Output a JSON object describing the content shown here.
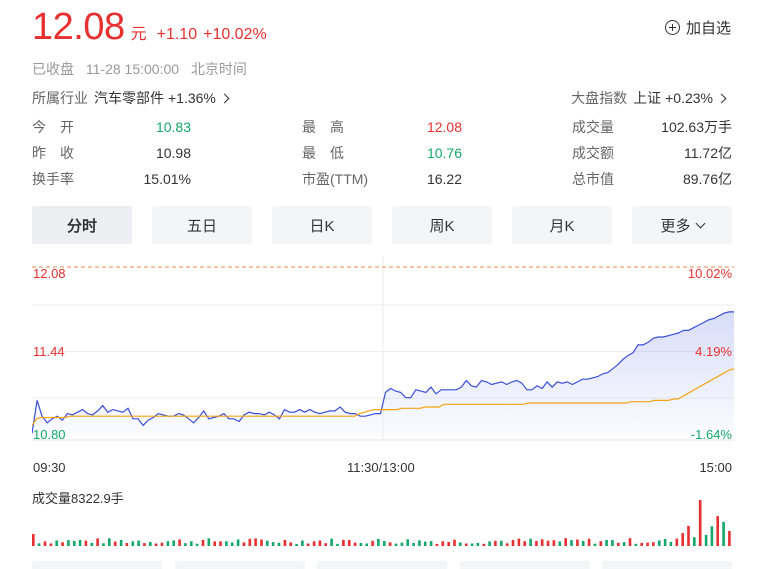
{
  "quote": {
    "price": "12.08",
    "unit": "元",
    "change": "+1.10",
    "change_pct": "+10.02%"
  },
  "watch_label": "加自选",
  "status": {
    "state": "已收盘",
    "datetime": "11-28 15:00:00",
    "timezone": "北京时间"
  },
  "industry": {
    "label": "所属行业",
    "name": "汽车零部件",
    "change": "+1.36%"
  },
  "market": {
    "label": "大盘指数",
    "name": "上证",
    "change": "+0.23%"
  },
  "stats": {
    "open_label": "今　开",
    "open": "10.83",
    "prev_close_label": "昨　收",
    "prev_close": "10.98",
    "turnover_rate_label": "换手率",
    "turnover_rate": "15.01%",
    "high_label": "最　高",
    "high": "12.08",
    "low_label": "最　低",
    "low": "10.76",
    "pe_label": "市盈(TTM)",
    "pe": "16.22",
    "volume_label": "成交量",
    "volume": "102.63万手",
    "amount_label": "成交额",
    "amount": "11.72亿",
    "market_cap_label": "总市值",
    "market_cap": "89.76亿"
  },
  "tabs": [
    "分时",
    "五日",
    "日K",
    "周K",
    "月K",
    "更多"
  ],
  "active_tab": "分时",
  "chart_data": {
    "type": "line",
    "y_left_labels": [
      "12.08",
      "11.44",
      "10.80"
    ],
    "y_right_labels": [
      "10.02%",
      "4.19%",
      "-1.64%"
    ],
    "x_labels": [
      "09:30",
      "11:30/13:00",
      "15:00"
    ],
    "ylim": [
      10.8,
      12.08
    ],
    "prev_close": 10.98,
    "limit_up": 12.08,
    "series": [
      {
        "color": "#3a4fd8",
        "values": [
          10.82,
          11.07,
          10.95,
          10.9,
          10.93,
          10.95,
          10.92,
          10.97,
          10.96,
          10.98,
          11.0,
          10.97,
          10.96,
          10.99,
          11.03,
          10.98,
          11.0,
          10.99,
          10.98,
          11.01,
          10.93,
          10.93,
          10.88,
          10.92,
          10.94,
          10.97,
          10.96,
          10.95,
          10.95,
          10.97,
          10.96,
          10.93,
          10.9,
          10.94,
          10.99,
          10.93,
          10.94,
          10.95,
          10.97,
          10.93,
          10.93,
          10.91,
          10.96,
          10.98,
          10.97,
          10.97,
          10.96,
          10.98,
          10.96,
          10.93,
          11.0,
          10.98,
          10.98,
          11.0,
          10.98,
          11.0,
          10.98,
          10.97,
          10.98,
          10.99,
          10.99,
          11.02,
          10.98,
          10.97,
          10.97,
          10.95,
          10.95,
          10.96,
          10.97,
          10.97,
          11.13,
          11.16,
          11.14,
          11.13,
          11.09,
          11.09,
          11.15,
          11.14,
          11.13,
          11.17,
          11.12,
          11.15,
          11.15,
          11.15,
          11.15,
          11.17,
          11.22,
          11.18,
          11.17,
          11.22,
          11.21,
          11.19,
          11.2,
          11.21,
          11.19,
          11.21,
          11.22,
          11.2,
          11.15,
          11.15,
          11.18,
          11.16,
          11.21,
          11.17,
          11.21,
          11.2,
          11.21,
          11.19,
          11.21,
          11.23,
          11.23,
          11.24,
          11.25,
          11.27,
          11.28,
          11.31,
          11.34,
          11.38,
          11.41,
          11.43,
          11.49,
          11.49,
          11.51,
          11.54,
          11.55,
          11.55,
          11.56,
          11.57,
          11.58,
          11.6,
          11.6,
          11.62,
          11.64,
          11.66,
          11.68,
          11.69,
          11.71,
          11.73,
          11.74,
          11.74
        ],
        "name": ""
      },
      {
        "color": "#f2a413",
        "values": [
          10.88,
          10.93,
          10.94,
          10.94,
          10.94,
          10.94,
          10.94,
          10.94,
          10.95,
          10.95,
          10.95,
          10.95,
          10.95,
          10.95,
          10.95,
          10.95,
          10.95,
          10.95,
          10.95,
          10.95,
          10.95,
          10.95,
          10.95,
          10.95,
          10.95,
          10.95,
          10.95,
          10.95,
          10.95,
          10.95,
          10.95,
          10.95,
          10.95,
          10.95,
          10.95,
          10.95,
          10.95,
          10.95,
          10.95,
          10.95,
          10.95,
          10.95,
          10.95,
          10.95,
          10.95,
          10.95,
          10.95,
          10.95,
          10.95,
          10.95,
          10.95,
          10.95,
          10.95,
          10.95,
          10.95,
          10.95,
          10.95,
          10.95,
          10.95,
          10.95,
          10.95,
          10.95,
          10.95,
          10.95,
          10.95,
          10.95,
          10.95,
          10.95,
          10.95,
          10.95,
          10.97,
          10.98,
          10.99,
          11.0,
          11.0,
          11.0,
          11.0,
          11.0,
          11.0,
          11.01,
          11.01,
          11.01,
          11.01,
          11.01,
          11.02,
          11.02,
          11.02,
          11.02,
          11.04,
          11.04,
          11.04,
          11.04,
          11.04,
          11.04,
          11.04,
          11.04,
          11.04,
          11.04,
          11.04,
          11.04,
          11.04,
          11.04,
          11.04,
          11.04,
          11.04,
          11.04,
          11.05,
          11.05,
          11.05,
          11.05,
          11.05,
          11.05,
          11.05,
          11.05,
          11.05,
          11.05,
          11.05,
          11.05,
          11.05,
          11.05,
          11.05,
          11.05,
          11.05,
          11.05,
          11.05,
          11.05,
          11.05,
          11.05,
          11.06,
          11.06,
          11.06,
          11.06,
          11.06,
          11.07,
          11.07,
          11.07,
          11.07,
          11.08,
          11.08,
          11.1,
          11.12,
          11.14,
          11.16,
          11.18,
          11.2,
          11.22,
          11.24,
          11.26,
          11.28,
          11.3,
          11.31
        ],
        "name": ""
      }
    ]
  },
  "volume": {
    "label": "成交量8322.9手"
  }
}
